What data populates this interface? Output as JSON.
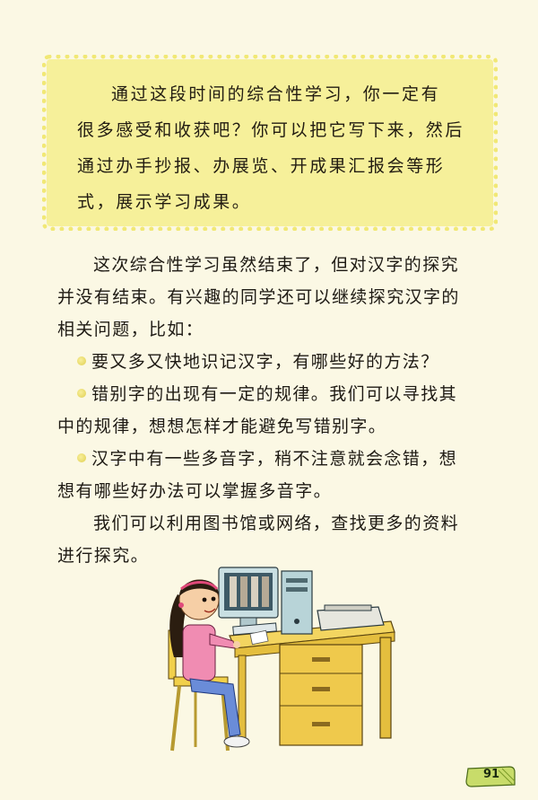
{
  "tip": {
    "lines": [
      "通过这段时间的综合性学习，你一定有",
      "很多感受和收获吧？你可以把它写下来，然后",
      "通过办手抄报、办展览、开成果汇报会等形",
      "式，展示学习成果。"
    ]
  },
  "body": {
    "intro": [
      "这次综合性学习虽然结束了，但对汉字的探究",
      "并没有结束。有兴趣的同学还可以继续探究汉字的",
      "相关问题，比如："
    ],
    "bullets": [
      [
        "要又多又快地识记汉字，有哪些好的方法？"
      ],
      [
        "错别字的出现有一定的规律。我们可以寻找其",
        "中的规律，想想怎样才能避免写错别字。"
      ],
      [
        "汉字中有一些多音字，稍不注意就会念错，想",
        "想有哪些好办法可以掌握多音字。"
      ]
    ],
    "closing": [
      "我们可以利用图书馆或网络，查找更多的资料",
      "进行探究。"
    ]
  },
  "page_number": "91",
  "colors": {
    "tip_background": "#f6f09a",
    "page_background": "#fbf8e4",
    "bullet": "#e0cf50",
    "page_tab": "#c8dc6a"
  },
  "illustration": {
    "icons": [
      "girl-icon",
      "computer-monitor-icon",
      "computer-tower-icon",
      "printer-icon",
      "desk-icon",
      "chair-icon"
    ]
  }
}
